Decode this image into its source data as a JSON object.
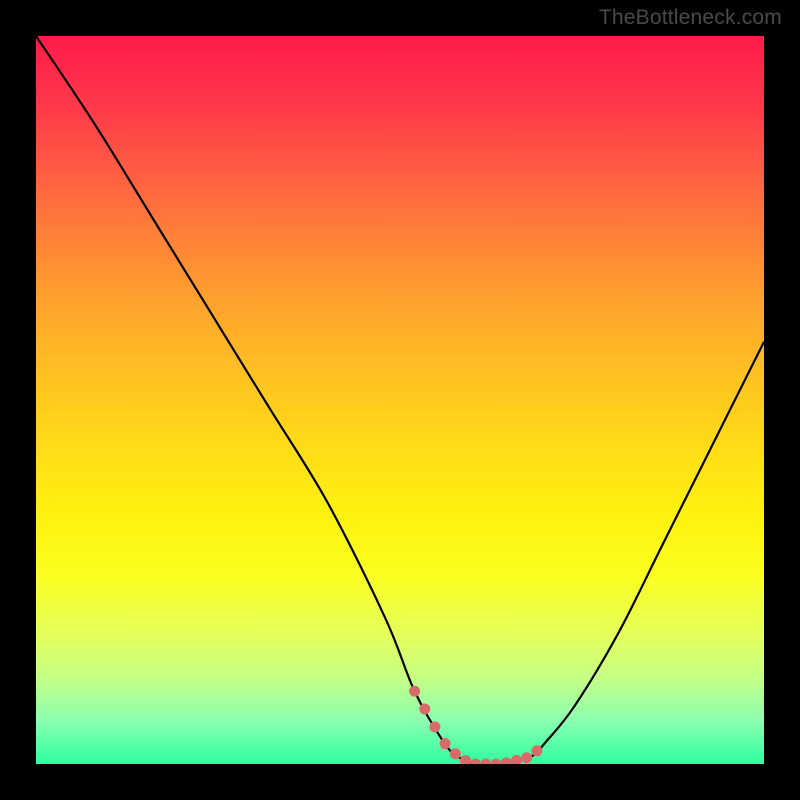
{
  "watermark": "TheBottleneck.com",
  "chart_data": {
    "type": "line",
    "title": "",
    "xlabel": "",
    "ylabel": "",
    "xlim": [
      0,
      100
    ],
    "ylim": [
      0,
      100
    ],
    "series": [
      {
        "name": "bottleneck-curve",
        "x": [
          0,
          8,
          16,
          24,
          32,
          40,
          48,
          52,
          56,
          58,
          60,
          64,
          68,
          70,
          74,
          80,
          86,
          92,
          100
        ],
        "y": [
          100,
          88,
          75,
          62,
          49,
          36,
          20,
          10,
          3,
          1,
          0,
          0,
          1,
          3,
          8,
          18,
          30,
          42,
          58
        ]
      }
    ],
    "highlight_segment": {
      "name": "bottom-dots",
      "x_start": 52,
      "x_end": 70,
      "color": "#d96a6a"
    },
    "background_gradient": {
      "top": "#ff1a4a",
      "mid": "#fff210",
      "bottom": "#2effa0"
    }
  }
}
